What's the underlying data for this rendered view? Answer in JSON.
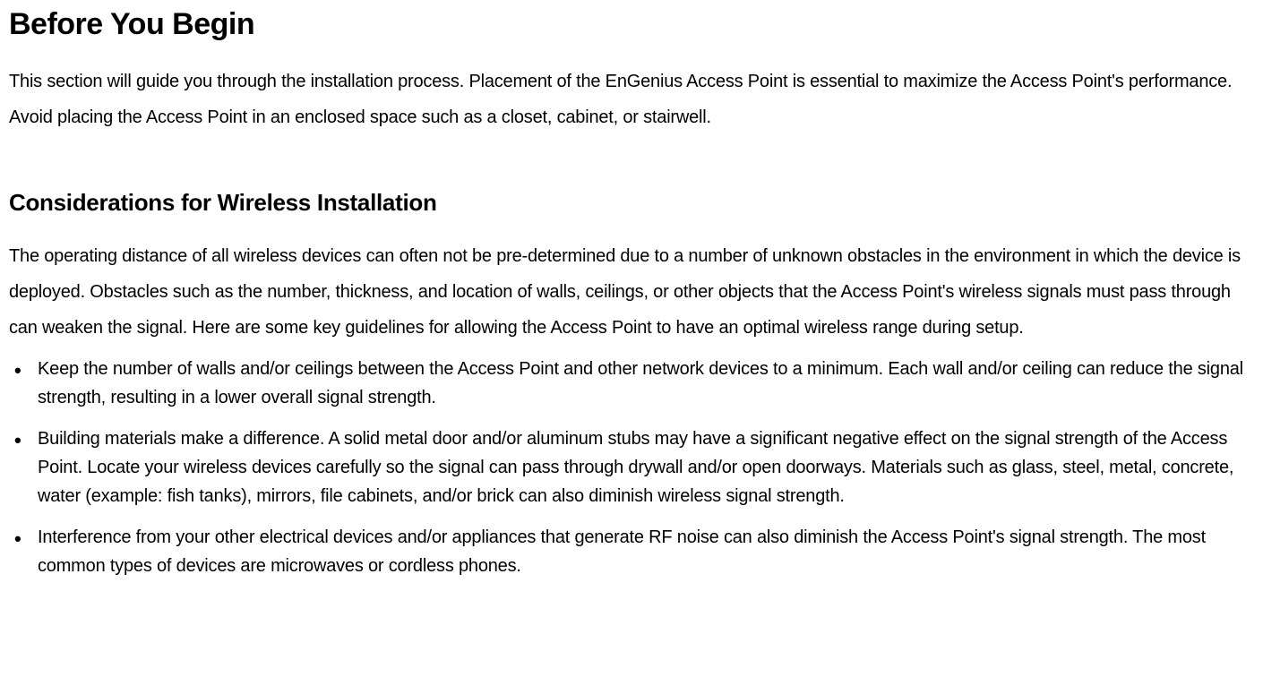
{
  "heading1": "Before You Begin",
  "paragraph1": "This section will guide you through the installation process. Placement of the EnGenius Access Point is essential to maximize the Access Point's performance. Avoid placing the Access Point in an enclosed space such as a closet, cabinet, or stairwell.",
  "heading2": "Considerations for Wireless Installation",
  "paragraph2": "The operating distance of all wireless devices can often not be pre-determined due to a number of unknown obstacles in the environment in which the device is deployed. Obstacles such as the number, thickness, and location of walls, ceilings, or other objects that the Access Point's wireless signals must pass through can weaken the signal. Here are some key guidelines for allowing the Access Point to have an optimal wireless range during setup.",
  "bullets": [
    "Keep the number of walls and/or ceilings between the Access Point and other network devices to a minimum. Each wall and/or ceiling can reduce the signal strength, resulting in a lower overall signal strength.",
    "Building materials make a difference. A solid metal door and/or aluminum stubs may have a significant negative effect on the signal strength of the Access Point. Locate your wireless devices carefully so the signal can pass through drywall and/or open doorways. Materials such as glass, steel, metal, concrete, water (example: fish tanks), mirrors, file cabinets, and/or brick can also diminish wireless signal strength.",
    "Interference from your other electrical devices and/or appliances that generate RF noise can also diminish the Access Point's signal strength. The most common types of devices are microwaves or cordless phones."
  ]
}
